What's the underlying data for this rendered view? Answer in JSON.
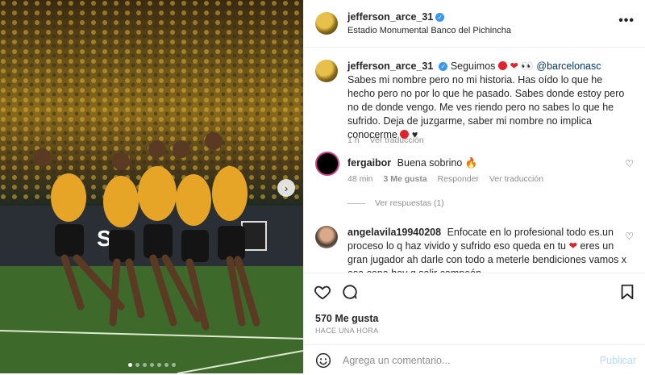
{
  "post": {
    "username": "jefferson_arce_31",
    "location": "Estadio Monumental Banco del Pichincha",
    "more_label": "•••"
  },
  "caption": {
    "username": "jefferson_arce_31",
    "lead": "Seguimos",
    "mention": "@barcelonasc",
    "text": "Sabes mi nombre pero no mi historia. Has oído lo que he hecho pero no por lo que he pasado. Sabes donde estoy pero no de donde vengo. Me ves riendo pero no sabes lo que he sufrido. Deja de juzgarme, saber mi nombre no implica conocerme",
    "age": "1 h",
    "translate": "Ver traducción"
  },
  "comments": [
    {
      "username": "fergaibor",
      "text": "Buena sobrino",
      "age": "48 min",
      "likes": "3 Me gusta",
      "reply": "Responder",
      "translate": "Ver traducción",
      "replies": "Ver respuestas (1)"
    },
    {
      "username": "angelavila19940208",
      "text": "Enfocate en lo profesional todo es.un proceso lo q haz vivido y sufrido eso queda en tu",
      "text2": "eres un gran jugador ah darle con todo a meterle bendiciones vamos x esa copa hay q salir campeón"
    }
  ],
  "stats": {
    "likes": "570 Me gusta",
    "time": "HACE UNA HORA"
  },
  "add_comment": {
    "placeholder": "Agrega un comentario...",
    "publish": "Publicar"
  },
  "carousel": {
    "total": 7,
    "active": 0
  },
  "icons": {
    "like": "heart-icon",
    "comment": "comment-bubble-icon",
    "save": "bookmark-icon",
    "emoji": "emoji-smiley-icon",
    "next": "chevron-right-icon",
    "verified": "verified-badge-icon"
  },
  "colors": {
    "accent_blue": "#3897f0",
    "publish_disabled": "#b3dbff",
    "red": "#e0242e"
  }
}
